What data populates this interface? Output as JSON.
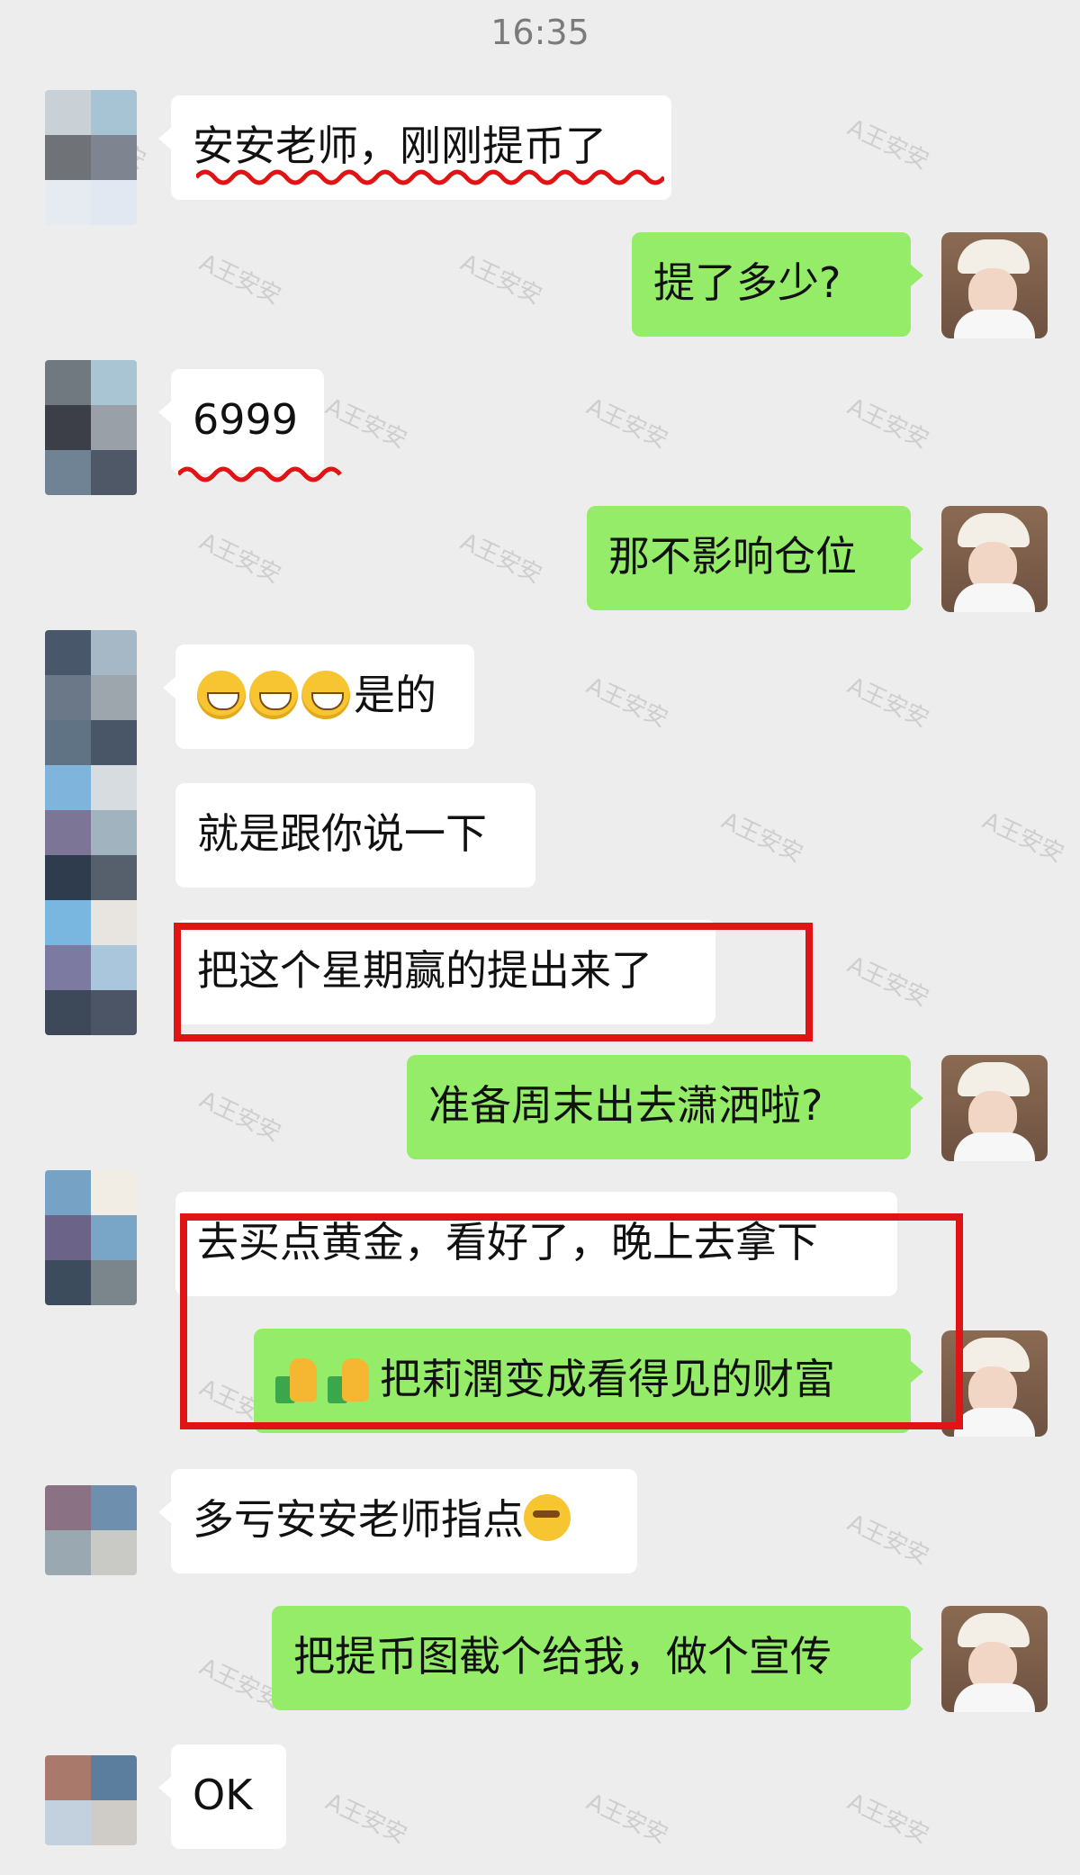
{
  "status": {
    "time": "16:35"
  },
  "watermark": "A王安安",
  "messages": [
    {
      "text": "安安老师，刚刚提币了"
    },
    {
      "text": "提了多少?"
    },
    {
      "text": "6999"
    },
    {
      "text": "那不影响仓位"
    },
    {
      "text": "是的",
      "emoji": "grin-emoji x3"
    },
    {
      "text": "就是跟你说一下"
    },
    {
      "text": "把这个星期赢的提出来了"
    },
    {
      "text": "准备周末出去潇洒啦?"
    },
    {
      "text": "去买点黄金，看好了，晚上去拿下"
    },
    {
      "text": "把莉潤变成看得见的财富",
      "emoji": "money-thumbs-up-emoji x2"
    },
    {
      "text": "多亏安安老师指点",
      "emoji": "thinking-emoji"
    },
    {
      "text": "把提币图截个给我，做个宣传"
    },
    {
      "text": "OK"
    }
  ],
  "colors": {
    "self_bubble": "#95ec69",
    "other_bubble": "#ffffff",
    "background": "#ededed",
    "highlight": "#e01414"
  }
}
